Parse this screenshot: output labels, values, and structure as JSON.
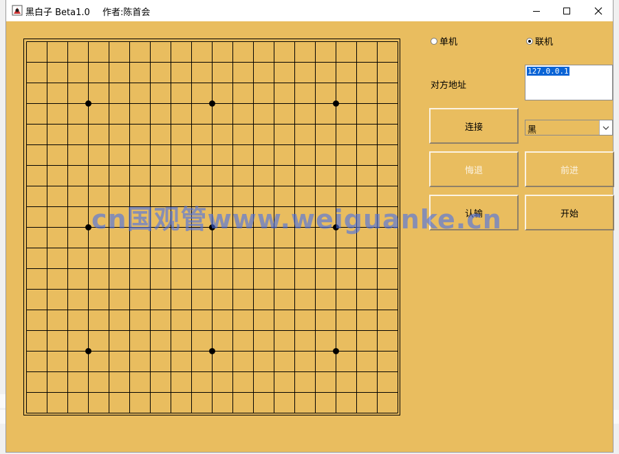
{
  "window": {
    "title": "黑白子 Beta1.0",
    "author": "作者:陈首会"
  },
  "board": {
    "lines": 19,
    "star_points": [
      [
        3,
        3
      ],
      [
        9,
        3
      ],
      [
        15,
        3
      ],
      [
        3,
        9
      ],
      [
        9,
        9
      ],
      [
        15,
        9
      ],
      [
        3,
        15
      ],
      [
        9,
        15
      ],
      [
        15,
        15
      ]
    ],
    "background": "#e9bd5f"
  },
  "controls": {
    "mode_single_label": "单机",
    "mode_online_label": "联机",
    "selected_mode": "联机",
    "address_label": "对方地址",
    "address_value": "127.0.0.1",
    "connect_label": "连接",
    "color_selected": "黑",
    "undo_label": "悔退",
    "forward_label": "前进",
    "resign_label": "认输",
    "start_label": "开始"
  },
  "watermark": "cn国观管www.weiguanke.cn",
  "colors": {
    "panel": "#e9bd5f",
    "selection": "#0a64d6"
  }
}
